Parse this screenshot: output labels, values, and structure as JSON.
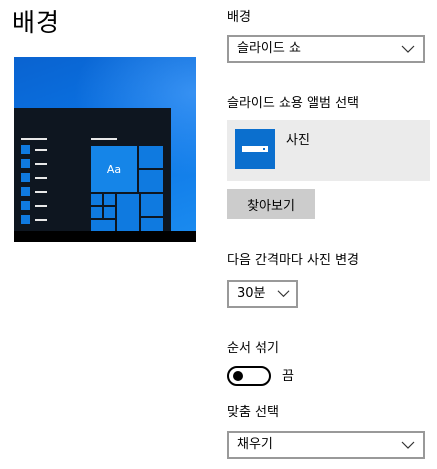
{
  "page": {
    "title": "배경"
  },
  "preview": {
    "tile_label": "Aa"
  },
  "background": {
    "label": "배경",
    "selected": "슬라이드 쇼"
  },
  "album": {
    "label": "슬라이드 쇼용 앨범 선택",
    "name": "사진",
    "icon": "folder-photo-icon",
    "browse_label": "찾아보기"
  },
  "interval": {
    "label": "다음 간격마다 사진 변경",
    "selected": "30분"
  },
  "shuffle": {
    "label": "순서 섞기",
    "state": "끔",
    "value": false
  },
  "fit": {
    "label": "맞춤 선택",
    "selected": "채우기"
  },
  "colors": {
    "accent": "#0b6fce",
    "button_bg": "#cccccc",
    "album_bg": "#ebebeb",
    "preview_blue": "#0b74e5"
  }
}
